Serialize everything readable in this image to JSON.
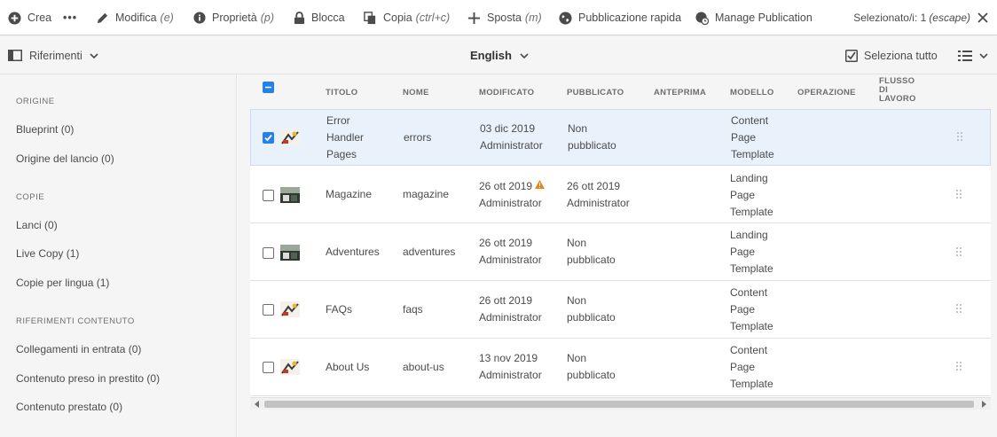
{
  "actionbar": {
    "create": "Crea",
    "more": "•••",
    "edit": "Modifica",
    "edit_key": "(e)",
    "properties": "Proprietà",
    "properties_key": "(p)",
    "lock": "Blocca",
    "copy": "Copia",
    "copy_key": "(ctrl+c)",
    "move": "Sposta",
    "move_key": "(m)",
    "quick_publish": "Pubblicazione rapida",
    "manage_publication": "Manage Publication",
    "selection": "Selezionato/i: 1",
    "selection_key": "(escape)"
  },
  "subbar": {
    "rail_label": "Riferimenti",
    "language": "English",
    "select_all": "Seleziona tutto"
  },
  "rail": {
    "h_origin": "ORIGINE",
    "blueprint": "Blueprint (0)",
    "launch_origin": "Origine del lancio (0)",
    "h_copies": "COPIE",
    "launches": "Lanci (0)",
    "live_copy": "Live Copy (1)",
    "language_copies": "Copie per lingua (1)",
    "h_content_refs": "RIFERIMENTI CONTENUTO",
    "incoming_links": "Collegamenti in entrata (0)",
    "borrowed_content": "Contenuto preso in prestito (0)",
    "lent_content": "Contenuto prestato (0)"
  },
  "table": {
    "headers": {
      "title": "TITOLO",
      "name": "NOME",
      "modified": "MODIFICATO",
      "published": "PUBBLICATO",
      "preview": "ANTEPRIMA",
      "template": "MODELLO",
      "operation": "OPERAZIONE",
      "workflow_1": "FLUSSO",
      "workflow_2": "DI",
      "workflow_3": "LAVORO"
    },
    "rows": [
      {
        "title_1": "Error",
        "title_2": "Handler",
        "title_3": "Pages",
        "name": "errors",
        "modified_date": "03 dic 2019",
        "modified_by": "Administrator",
        "published_1": "Non",
        "published_2": "pubblicato",
        "template_1": "Content",
        "template_2": "Page",
        "template_3": "Template",
        "selected": true,
        "warning": false
      },
      {
        "title_1": "Magazine",
        "name": "magazine",
        "modified_date": "26 ott 2019",
        "modified_by": "Administrator",
        "published_1": "26 ott 2019",
        "published_2": "Administrator",
        "template_1": "Landing",
        "template_2": "Page",
        "template_3": "Template",
        "selected": false,
        "warning": true
      },
      {
        "title_1": "Adventures",
        "name": "adventures",
        "modified_date": "26 ott 2019",
        "modified_by": "Administrator",
        "published_1": "Non",
        "published_2": "pubblicato",
        "template_1": "Landing",
        "template_2": "Page",
        "template_3": "Template",
        "selected": false,
        "warning": false
      },
      {
        "title_1": "FAQs",
        "name": "faqs",
        "modified_date": "26 ott 2019",
        "modified_by": "Administrator",
        "published_1": "Non",
        "published_2": "pubblicato",
        "template_1": "Content",
        "template_2": "Page",
        "template_3": "Template",
        "selected": false,
        "warning": false
      },
      {
        "title_1": "About Us",
        "name": "about-us",
        "modified_date": "13 nov 2019",
        "modified_by": "Administrator",
        "published_1": "Non",
        "published_2": "pubblicato",
        "template_1": "Content",
        "template_2": "Page",
        "template_3": "Template",
        "selected": false,
        "warning": false
      }
    ]
  },
  "colors": {
    "accent": "#2680eb",
    "warning": "#e68619",
    "selected_row": "#e9f1fb"
  }
}
